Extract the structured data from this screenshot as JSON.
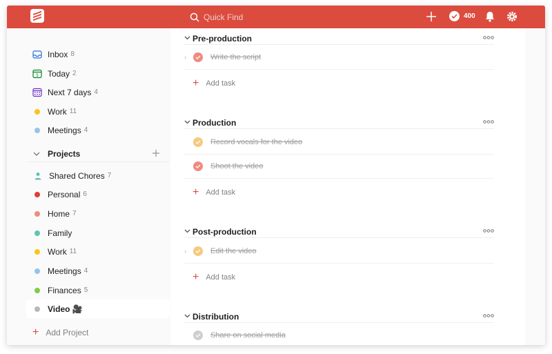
{
  "search": {
    "placeholder": "Quick Find"
  },
  "karma": {
    "points": "400"
  },
  "sidebar": {
    "items": [
      {
        "label": "Inbox",
        "count": "8"
      },
      {
        "label": "Today",
        "count": "2"
      },
      {
        "label": "Next 7 days",
        "count": "4"
      },
      {
        "label": "Work",
        "count": "11",
        "color": "#f9c51b"
      },
      {
        "label": "Meetings",
        "count": "4",
        "color": "#96c3eb"
      }
    ],
    "projects_label": "Projects",
    "projects": [
      {
        "label": "Shared Chores",
        "count": "7",
        "color": "#5ec1ba"
      },
      {
        "label": "Personal",
        "count": "6",
        "color": "#db4035"
      },
      {
        "label": "Home",
        "count": "7",
        "color": "#ef8b7e"
      },
      {
        "label": "Family",
        "count": "",
        "color": "#5fc5b2"
      },
      {
        "label": "Work",
        "count": "11",
        "color": "#f9c51b"
      },
      {
        "label": "Meetings",
        "count": "4",
        "color": "#96c3eb"
      },
      {
        "label": "Finances",
        "count": "5",
        "color": "#7ecc49"
      },
      {
        "label": "Video 🎥",
        "count": "",
        "color": "#b8b8b8"
      }
    ],
    "add_project": "Add Project"
  },
  "sections": [
    {
      "title": "Pre-production",
      "tasks": [
        {
          "text": "Write the script",
          "color": "#ef8b7e"
        }
      ],
      "add_label": "Add task"
    },
    {
      "title": "Production",
      "tasks": [
        {
          "text": "Record vocals for the video",
          "color": "#f7c97f"
        },
        {
          "text": "Shoot the video",
          "color": "#ef8b7e"
        }
      ],
      "add_label": "Add task"
    },
    {
      "title": "Post-production",
      "tasks": [
        {
          "text": "Edit the video",
          "color": "#f7c97f"
        }
      ],
      "add_label": "Add task"
    },
    {
      "title": "Distribution",
      "tasks": [
        {
          "text": "Share on social media",
          "color": "#cfcfcf"
        }
      ],
      "add_label": ""
    }
  ],
  "colors": {
    "brand": "#db4c3f"
  }
}
